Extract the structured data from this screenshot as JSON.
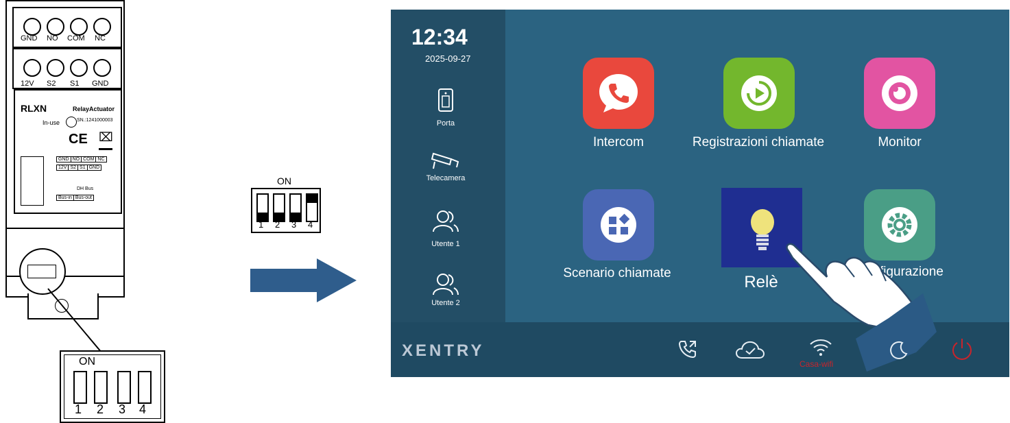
{
  "relay": {
    "top_terminals": [
      "GND",
      "NO",
      "COM",
      "NC"
    ],
    "bottom_terminals": [
      "12V",
      "S2",
      "S1",
      "GND"
    ],
    "model": "RLXN",
    "subtitle": "RelayActuator",
    "in_use": "In-use",
    "serial": "SN.:1241000003",
    "ce": "CE",
    "table_row1": [
      "GND",
      "NO",
      "COM",
      "NC"
    ],
    "table_row2": [
      "12V",
      "S2",
      "S1",
      "GND"
    ],
    "dh_bus": "DH Bus",
    "bus_in": "Bus-in",
    "bus_out": "Bus-out"
  },
  "dip_zoom": {
    "on_label": "ON",
    "numbers": [
      "1",
      "2",
      "3",
      "4"
    ]
  },
  "dip_setting": {
    "on_label": "ON",
    "numbers": [
      "1",
      "2",
      "3",
      "4"
    ],
    "states": [
      "off",
      "off",
      "off",
      "on"
    ]
  },
  "colors": {
    "arrow": "#2f5d8c",
    "screen_bg": "#234e66",
    "intercom": "#e9483d",
    "registrazioni": "#73b72d",
    "monitor": "#e254a2",
    "scenario": "#4a67b4",
    "rele": "#1f2e91",
    "configurazione": "#4a9e86",
    "wifi_label": "#c9242b",
    "power": "#c9242b"
  },
  "screen": {
    "time": "12:34",
    "date": "2025-09-27",
    "sidebar": [
      {
        "label": "Porta",
        "icon": "door-icon"
      },
      {
        "label": "Telecamera",
        "icon": "camera-icon"
      },
      {
        "label": "Utente 1",
        "icon": "users-icon"
      },
      {
        "label": "Utente 2",
        "icon": "users-icon"
      }
    ],
    "apps": [
      {
        "label": "Intercom",
        "icon": "phone-icon"
      },
      {
        "label": "Registrazioni chiamate",
        "icon": "play-record-icon"
      },
      {
        "label": "Monitor",
        "icon": "eye-icon"
      },
      {
        "label": "Scenario chiamate",
        "icon": "grid-icon"
      },
      {
        "label": "Relè",
        "icon": "bulb-icon"
      },
      {
        "label": "Configurazione",
        "icon": "gear-icon"
      }
    ],
    "brand": "XENTRY",
    "wifi_label": "Casa-wifi",
    "bottom_icons": [
      "call-forward-icon",
      "cloud-check-icon",
      "wifi-icon",
      "moon-icon",
      "power-icon"
    ]
  }
}
